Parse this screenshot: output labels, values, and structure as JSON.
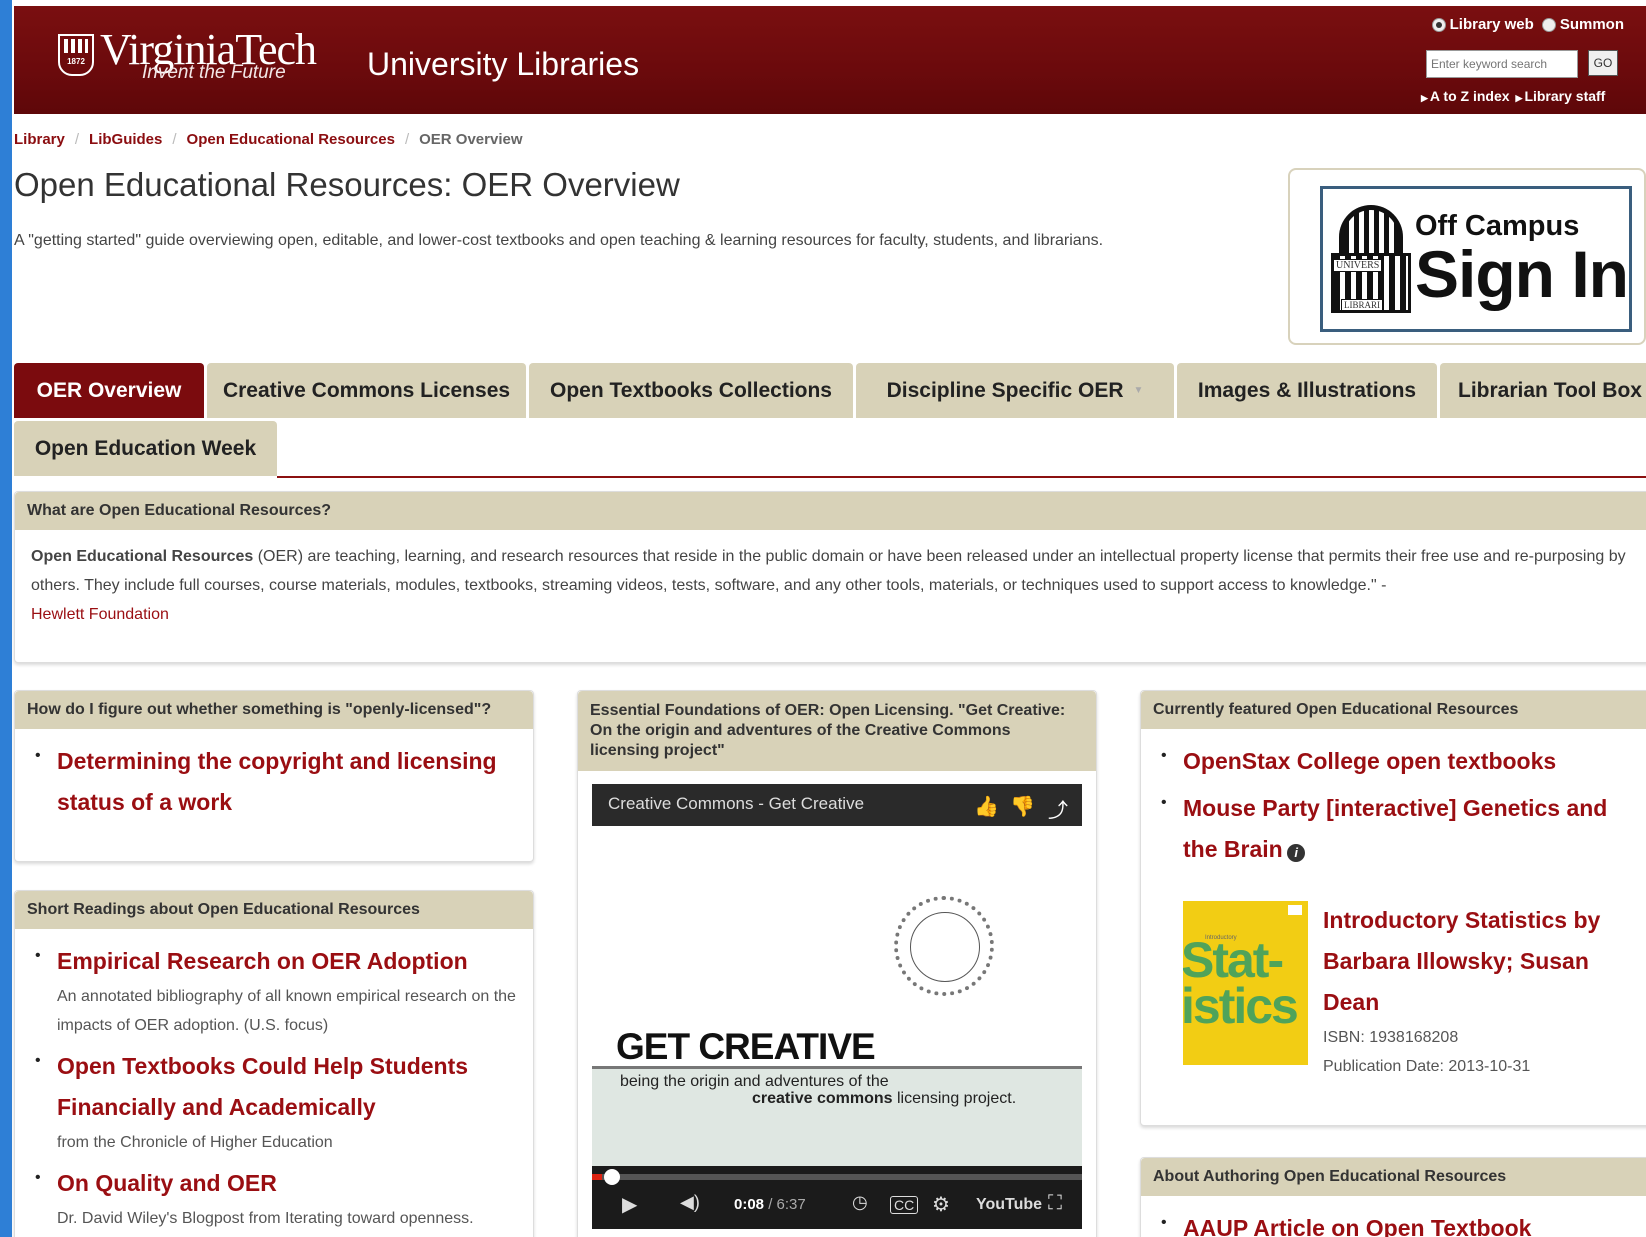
{
  "header": {
    "logo_name": "VirginiaTech",
    "logo_year": "1872",
    "tagline": "Invent the Future",
    "site_title": "University Libraries",
    "search": {
      "options": [
        "Library web",
        "Summon"
      ],
      "placeholder": "Enter keyword search",
      "go_label": "GO"
    },
    "quick_links": [
      "A to Z index",
      "Library staff"
    ]
  },
  "breadcrumb": [
    "Library",
    "LibGuides",
    "Open Educational Resources",
    "OER Overview"
  ],
  "page": {
    "title": "Open Educational Resources: OER Overview",
    "description": "A \"getting started\" guide overviewing open, editable, and lower-cost textbooks and open teaching & learning resources for faculty, students, and librarians."
  },
  "signin": {
    "line1": "Off Campus",
    "line2": "Sign In",
    "label1": "UNIVERS",
    "label2": "LIBRARI"
  },
  "tabs": [
    {
      "label": "OER Overview",
      "active": true
    },
    {
      "label": "Creative Commons Licenses"
    },
    {
      "label": "Open Textbooks Collections"
    },
    {
      "label": "Discipline Specific OER",
      "dropdown": true
    },
    {
      "label": "Images & Illustrations"
    },
    {
      "label": "Librarian Tool Box"
    },
    {
      "label": "Open Education Week"
    }
  ],
  "what_box": {
    "title": "What are Open Educational Resources?",
    "bold": "Open Educational Resources",
    "text": " (OER) are teaching, learning, and research resources that reside in the public domain or have been released under an intellectual property license that permits their free use and re-purposing by others. They include full courses, course materials, modules, textbooks, streaming videos, tests, software, and any other tools, materials, or techniques used to support access to knowledge.\" -",
    "link": "Hewlett Foundation"
  },
  "license_box": {
    "title": "How do I figure out whether something is \"openly-licensed\"?",
    "links": [
      "Determining the copyright and licensing status of a work"
    ]
  },
  "readings_box": {
    "title": "Short Readings about Open Educational Resources",
    "items": [
      {
        "title": "Empirical Research on OER Adoption",
        "desc": "An annotated bibliography of all known empirical research on the impacts of OER adoption. (U.S. focus)"
      },
      {
        "title": "Open Textbooks Could Help Students Financially and Academically",
        "desc": "from the Chronicle of Higher Education"
      },
      {
        "title": "On Quality and OER",
        "desc": "Dr. David Wiley's Blogpost from Iterating toward openness."
      }
    ]
  },
  "video_box": {
    "title": "Essential Foundations of OER: Open Licensing. \"Get Creative: On the origin and adventures of the Creative Commons licensing project\"",
    "video_title": "Creative Commons - Get Creative",
    "headline": "GET CREATIVE",
    "line1": "being the origin and adventures of the",
    "line2_bold": "creative commons",
    "line2_rest": " licensing project.",
    "time_current": "0:08",
    "time_total": " / 6:37",
    "progress": 0.02,
    "youtube": "YouTube"
  },
  "featured_box": {
    "title": "Currently featured Open Educational Resources",
    "links": [
      "OpenStax College open textbooks",
      "Mouse Party [interactive] Genetics and the Brain"
    ],
    "book": {
      "title": "Introductory Statistics by Barbara Illowsky; Susan Dean",
      "isbn": "ISBN: 1938168208",
      "pub_date": "Publication Date: 2013-10-31",
      "cover_text": "Stat-istics",
      "cover_small": "Introductory"
    }
  },
  "authoring_box": {
    "title": "About Authoring Open Educational Resources",
    "first_link": "AAUP Article on Open Textbook"
  }
}
